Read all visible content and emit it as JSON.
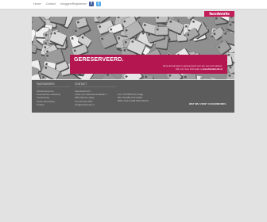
{
  "topnav": {
    "items": [
      "Home",
      "Contact",
      "Inloggen/Registreren"
    ]
  },
  "socials": [
    {
      "name": "facebook-icon",
      "glyph": "f",
      "color": "#3b5998"
    },
    {
      "name": "twitter-icon",
      "glyph": "t",
      "color": "#55acee"
    }
  ],
  "logo": {
    "text": "facedworks"
  },
  "banner": {
    "title": "GERESERVEERD.",
    "line1": "Deze domeinnaam is gereserveerd voor een van onze klanten.",
    "line2_prefix": "Kijk voor meer informatie op",
    "line2_link": "www.facedworks.nl"
  },
  "footer": {
    "col1": {
      "title": "FACEDWORKS",
      "items": [
        "Webdevelopment",
        "Zoekmachine marketing",
        "Social Media",
        "Online Advertising",
        "Hosting"
      ]
    },
    "col2": {
      "title": "CONTACT",
      "items": [
        "Facedworks B.V.",
        "Johan van Oldenbarneveltlaan 4",
        "2582 NE Den Haag",
        "Tel: 070 310 7000",
        "info@facedworks.nl"
      ]
    },
    "col3": {
      "items": [
        "Kvk: 27297500 Den Haag",
        "Btw: NL8189.70.412.B01",
        "IBAN: NL01 INGB 000 0000 00"
      ]
    },
    "cta": "WAT WIJ ZIEN? FACEDWORKS"
  },
  "colors": {
    "accent": "#b4174f",
    "footer_bg": "#5c5c5c",
    "page_bg": "#e2e2e2"
  }
}
